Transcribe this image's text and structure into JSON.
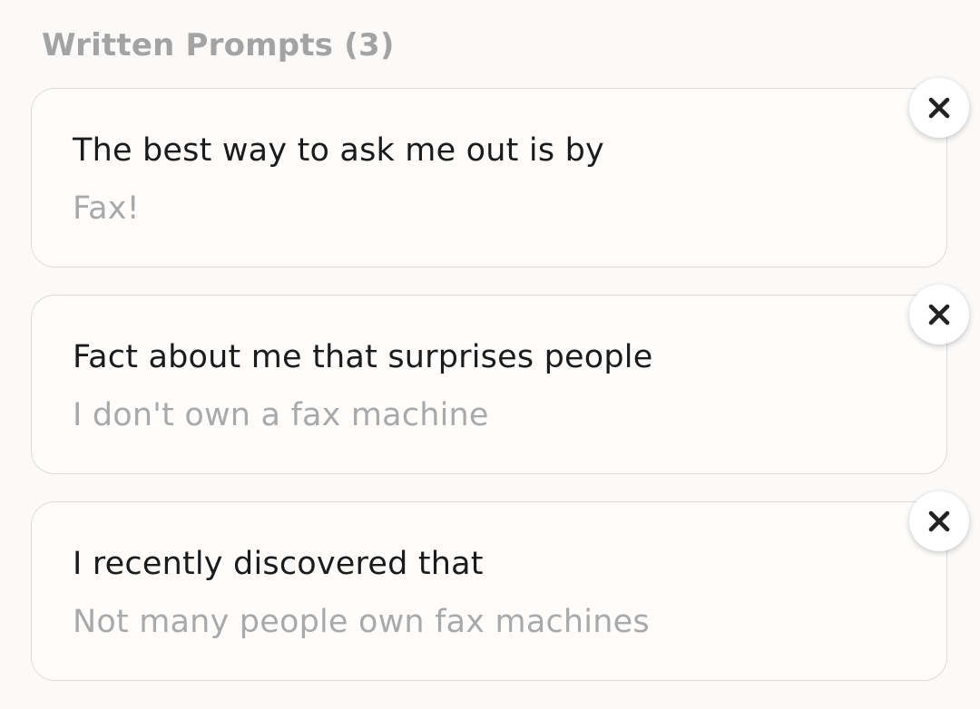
{
  "section": {
    "title": "Written Prompts (3)"
  },
  "prompts": [
    {
      "question": "The best way to ask me out is by",
      "answer": "Fax!"
    },
    {
      "question": "Fact about me that surprises people",
      "answer": "I don't own a fax machine"
    },
    {
      "question": "I recently discovered that",
      "answer": "Not many people own fax machines"
    }
  ],
  "icons": {
    "remove": "close-icon"
  },
  "colors": {
    "background": "#fbfaf9",
    "card_border": "#dcdcdc",
    "question_text": "#1b1b1b",
    "answer_text": "#a9a9a9",
    "title_text": "#a3a3a3"
  }
}
